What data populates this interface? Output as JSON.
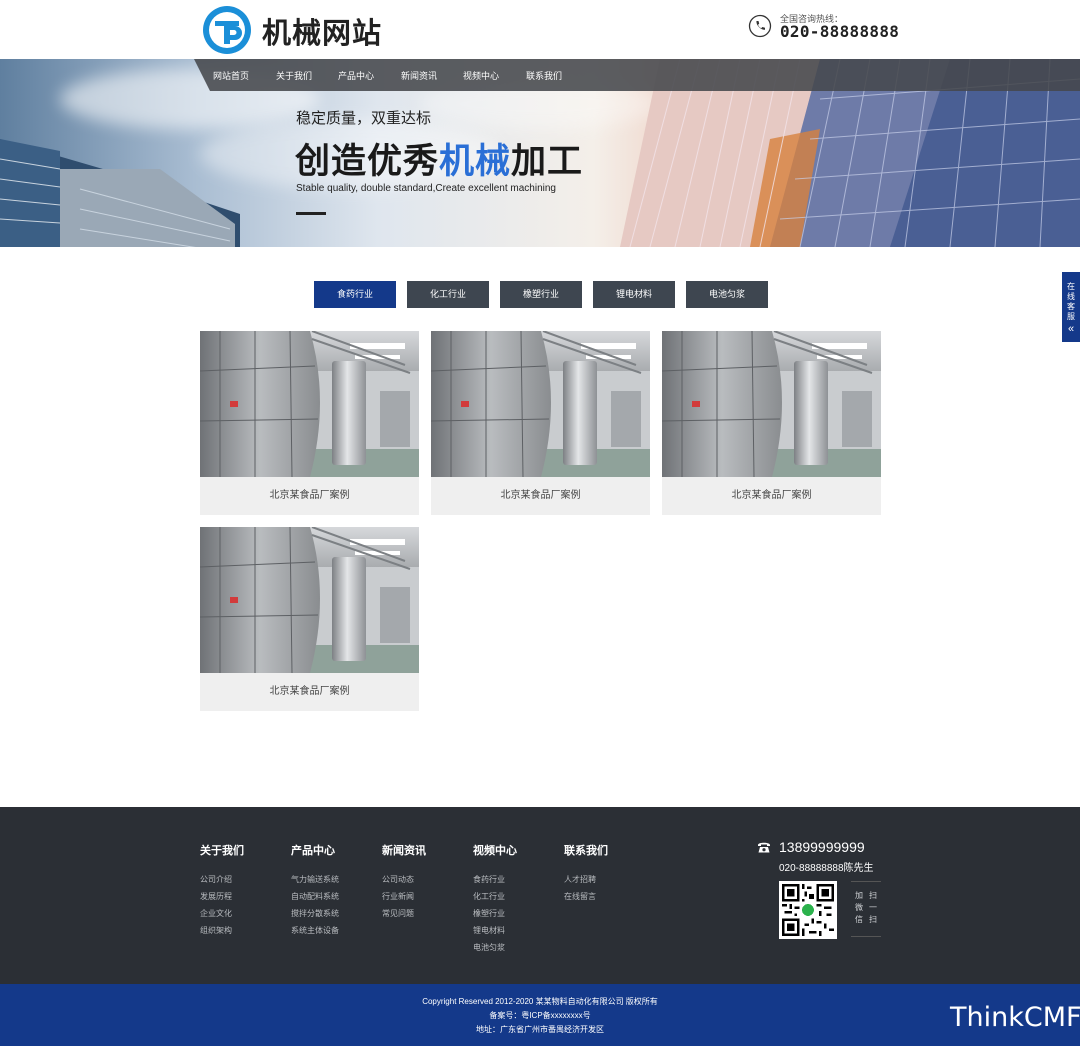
{
  "header": {
    "site_title": "机械网站",
    "hotline_label": "全国咨询热线：",
    "hotline_number": "020-88888888"
  },
  "nav": {
    "items": [
      {
        "label": "网站首页"
      },
      {
        "label": "关于我们"
      },
      {
        "label": "产品中心"
      },
      {
        "label": "新闻资讯"
      },
      {
        "label": "视频中心"
      },
      {
        "label": "联系我们"
      }
    ]
  },
  "banner": {
    "subtitle": "稳定质量，双重达标",
    "title_prefix": "创造优秀",
    "title_highlight": "机械",
    "title_suffix": "加工",
    "english": "Stable quality, double standard,Create excellent machining"
  },
  "tabs": [
    {
      "label": "食药行业",
      "active": true
    },
    {
      "label": "化工行业",
      "active": false
    },
    {
      "label": "橡塑行业",
      "active": false
    },
    {
      "label": "锂电材料",
      "active": false
    },
    {
      "label": "电池匀浆",
      "active": false
    }
  ],
  "cases": [
    {
      "caption": "北京某食品厂案例"
    },
    {
      "caption": "北京某食品厂案例"
    },
    {
      "caption": "北京某食品厂案例"
    },
    {
      "caption": "北京某食品厂案例"
    }
  ],
  "side_service": {
    "label": "在线客服",
    "arrow": "«"
  },
  "footer": {
    "columns": [
      {
        "title": "关于我们",
        "links": [
          "公司介绍",
          "发展历程",
          "企业文化",
          "组织架构"
        ]
      },
      {
        "title": "产品中心",
        "links": [
          "气力输送系统",
          "自动配料系统",
          "搅拌分散系统",
          "系统主体设备"
        ]
      },
      {
        "title": "新闻资讯",
        "links": [
          "公司动态",
          "行业新闻",
          "常见问题"
        ]
      },
      {
        "title": "视频中心",
        "links": [
          "食药行业",
          "化工行业",
          "橡塑行业",
          "锂电材料",
          "电池匀浆"
        ]
      },
      {
        "title": "联系我们",
        "links": [
          "人才招聘",
          "在线留言"
        ]
      }
    ],
    "phone": "13899999999",
    "contact": "020-88888888陈先生",
    "qr_text_col1": "加微信",
    "qr_text_col2": "扫一扫"
  },
  "copyright": {
    "line1": "Copyright Reserved 2012-2020 某某物料自动化有限公司 版权所有",
    "line2": "备案号：粤ICP备xxxxxxxx号",
    "line3": "地址：广东省广州市番禺经济开发区"
  },
  "watermark": "ThinkCMF",
  "colors": {
    "brand_blue": "#14398a",
    "highlight_blue": "#2a6fd6",
    "tab_dark": "#3e4650",
    "footer_bg": "#2b2f35"
  },
  "icons": {
    "logo": "tp-circle-logo",
    "phone": "phone-icon",
    "footer_phone": "telephone-icon",
    "qr": "qr-code-icon"
  }
}
